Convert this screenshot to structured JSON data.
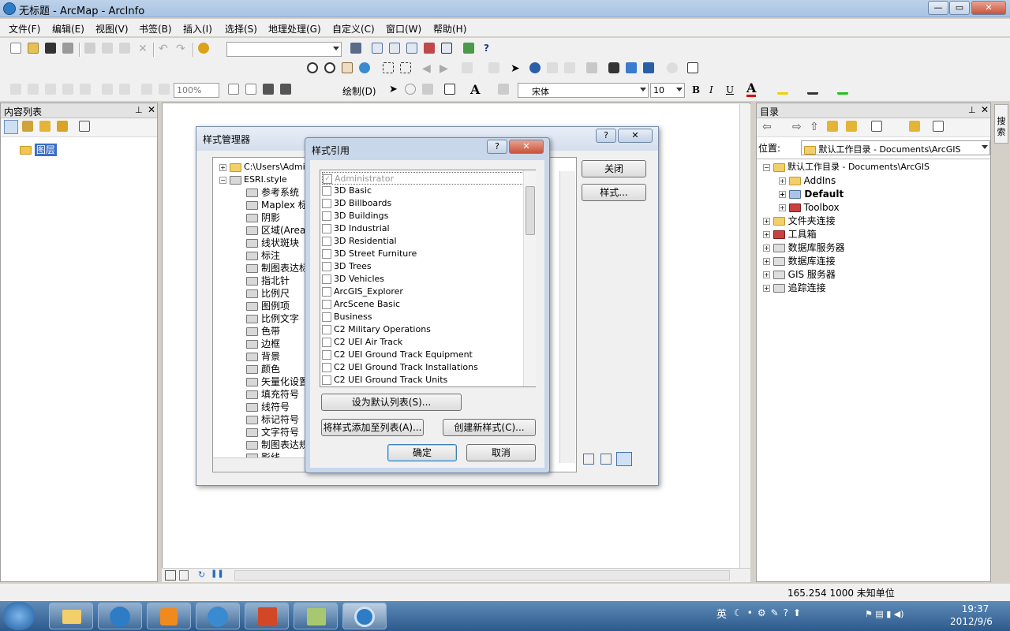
{
  "window": {
    "title": "无标题 - ArcMap - ArcInfo"
  },
  "menu": [
    "文件(F)",
    "编辑(E)",
    "视图(V)",
    "书签(B)",
    "插入(I)",
    "选择(S)",
    "地理处理(G)",
    "自定义(C)",
    "窗口(W)",
    "帮助(H)"
  ],
  "toolbar": {
    "zoom": "100%",
    "draw_label": "绘制(D)",
    "font": "宋体",
    "font_size": "10",
    "bold": "B",
    "italic": "I",
    "underline": "U",
    "text_A": "A"
  },
  "toc": {
    "title": "内容列表",
    "layer": "图层"
  },
  "catalog": {
    "title": "目录",
    "location_label": "位置:",
    "location_value": "默认工作目录 - Documents\\ArcGIS",
    "root": "默认工作目录 - Documents\\ArcGIS",
    "children": [
      "AddIns",
      "Default",
      "Toolbox"
    ],
    "items": [
      "文件夹连接",
      "工具箱",
      "数据库服务器",
      "数据库连接",
      "GIS 服务器",
      "追踪连接"
    ]
  },
  "side_tab": "搜索",
  "style_manager": {
    "title": "样式管理器",
    "help": "?",
    "close_x": "✕",
    "tree_root": "C:\\Users\\Admin",
    "style_file": "ESRI.style",
    "folders": [
      "参考系统",
      "Maplex 标注",
      "阴影",
      "区域(Area)补",
      "线状斑块",
      "标注",
      "制图表达标",
      "指北针",
      "比例尺",
      "图例项",
      "比例文字",
      "色带",
      "边框",
      "背景",
      "颜色",
      "矢量化设置",
      "填充符号",
      "线符号",
      "标记符号",
      "文字符号",
      "制图表达规",
      "影线"
    ],
    "close_button": "关闭",
    "styles_button": "样式..."
  },
  "style_ref": {
    "title": "样式引用",
    "help": "?",
    "items": [
      "Administrator",
      "3D Basic",
      "3D Billboards",
      "3D Buildings",
      "3D Industrial",
      "3D Residential",
      "3D Street Furniture",
      "3D Trees",
      "3D Vehicles",
      "ArcGIS_Explorer",
      "ArcScene Basic",
      "Business",
      "C2 Military Operations",
      "C2 UEI Air Track",
      "C2 UEI Ground Track Equipment",
      "C2 UEI Ground Track Installations",
      "C2 UEI Ground Track Units"
    ],
    "set_default": "设为默认列表(S)...",
    "add_style": "将样式添加至列表(A)...",
    "create_style": "创建新样式(C)...",
    "ok": "确定",
    "cancel": "取消"
  },
  "status": {
    "coords": "165.254  1000 未知单位"
  },
  "tray": {
    "ime": "英",
    "time": "19:37",
    "date": "2012/9/6"
  }
}
